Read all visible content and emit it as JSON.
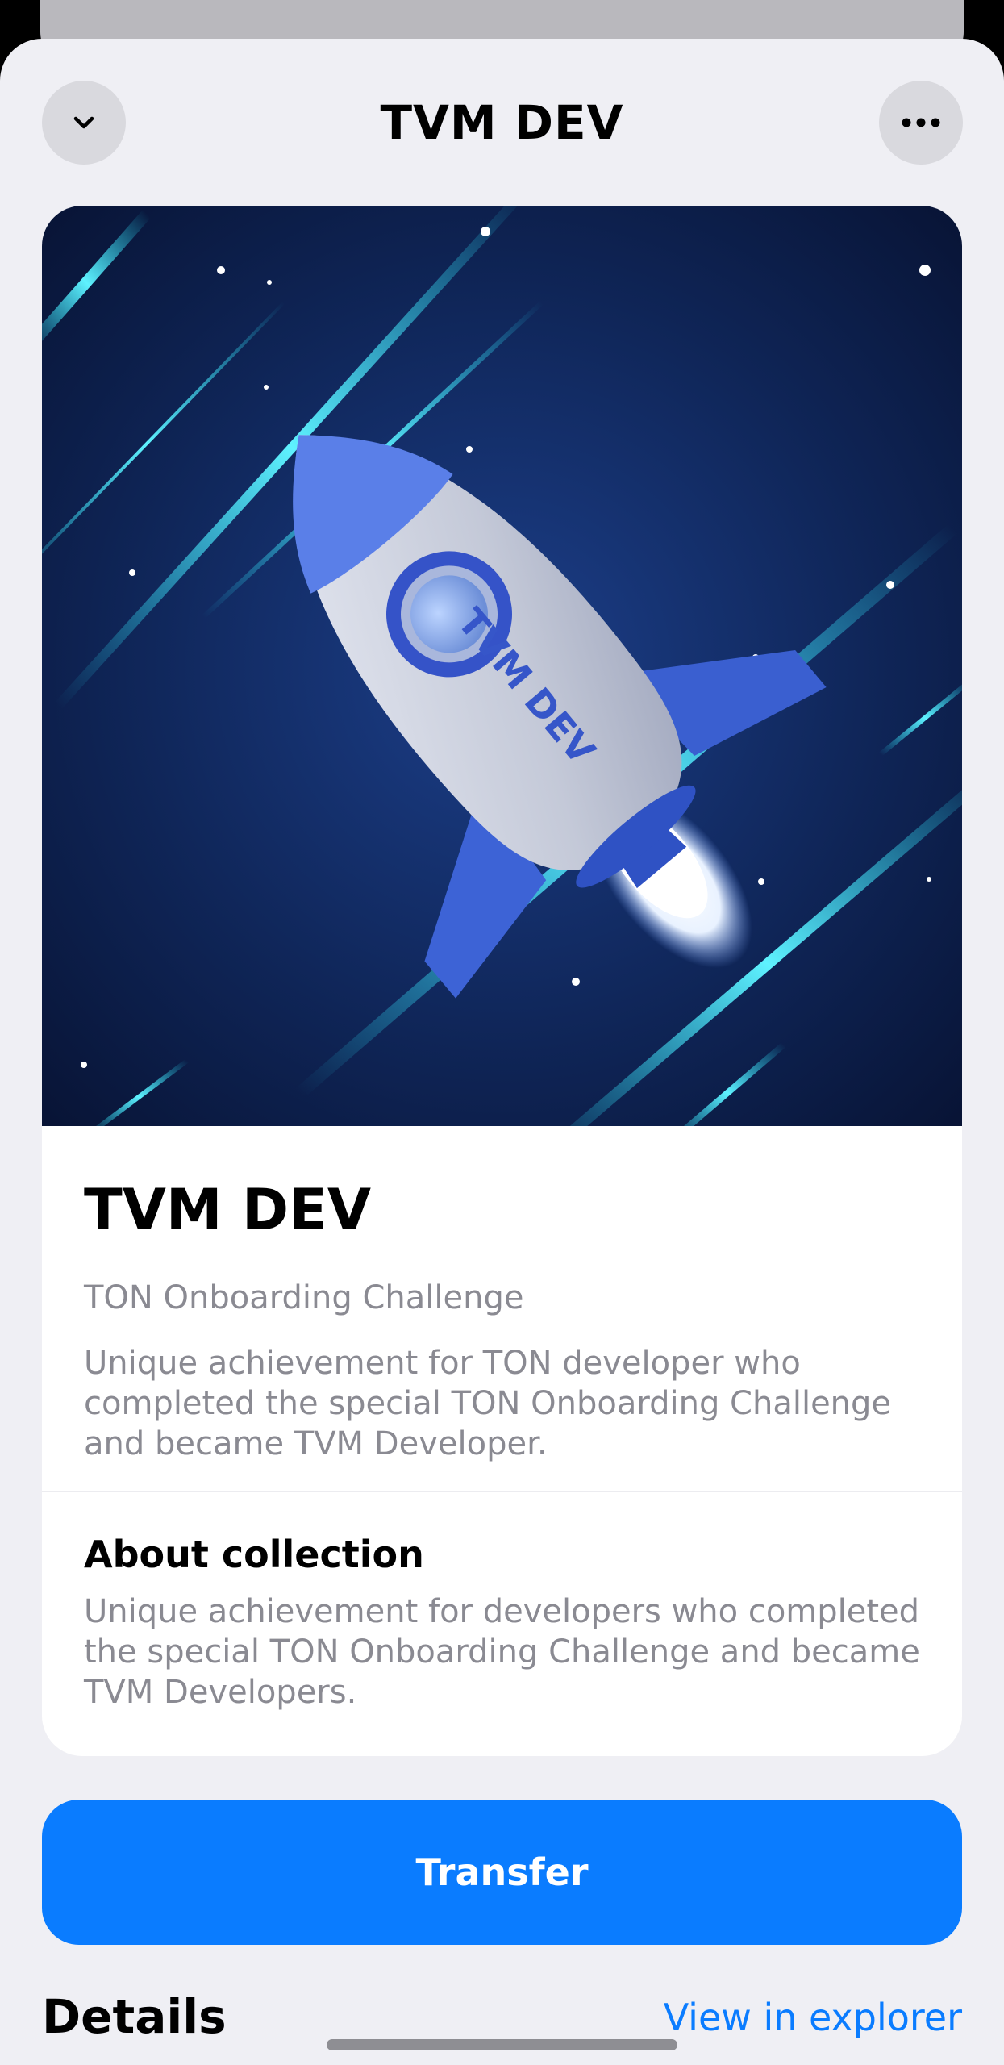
{
  "nav": {
    "title": "TVM DEV",
    "collapse_icon": "chevron-down-icon",
    "more_icon": "more-icon"
  },
  "nft": {
    "image_icon": "rocket-illustration",
    "image_text": "TVM DEV",
    "name": "TVM DEV",
    "collection": "TON Onboarding Challenge",
    "description": "Unique achievement for TON developer who completed the special TON Onboarding Challenge and became TVM Developer."
  },
  "about": {
    "title": "About collection",
    "description": "Unique achievement for developers who completed the special TON Onboarding Challenge and became TVM Developers."
  },
  "actions": {
    "transfer_label": "Transfer"
  },
  "details": {
    "title": "Details",
    "explorer_link": "View in explorer"
  },
  "colors": {
    "accent": "#0a7cff",
    "sheet_bg": "#efeff4",
    "secondary_text": "#8a8a92"
  }
}
